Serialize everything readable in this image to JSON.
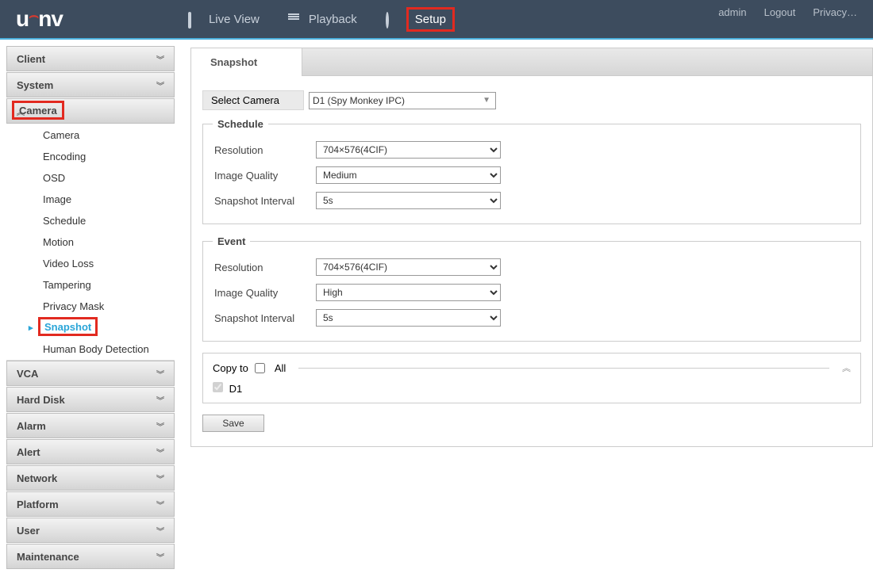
{
  "header": {
    "logo": "unv",
    "nav": {
      "live": "Live View",
      "playback": "Playback",
      "setup": "Setup"
    },
    "user": {
      "name": "admin",
      "logout": "Logout",
      "privacy": "Privacy…"
    }
  },
  "sidebar": {
    "client": "Client",
    "system": "System",
    "camera": "Camera",
    "camera_items": {
      "camera": "Camera",
      "encoding": "Encoding",
      "osd": "OSD",
      "image": "Image",
      "schedule": "Schedule",
      "motion": "Motion",
      "videoloss": "Video Loss",
      "tampering": "Tampering",
      "privacymask": "Privacy Mask",
      "snapshot": "Snapshot",
      "humanbody": "Human Body Detection"
    },
    "vca": "VCA",
    "harddisk": "Hard Disk",
    "alarm": "Alarm",
    "alert": "Alert",
    "network": "Network",
    "platform": "Platform",
    "user": "User",
    "maintenance": "Maintenance"
  },
  "tab": {
    "snapshot": "Snapshot"
  },
  "form": {
    "select_camera_label": "Select Camera",
    "select_camera_value": "D1 (Spy Monkey IPC)",
    "schedule_legend": "Schedule",
    "event_legend": "Event",
    "resolution_label": "Resolution",
    "quality_label": "Image Quality",
    "interval_label": "Snapshot Interval",
    "schedule": {
      "resolution": "704×576(4CIF)",
      "quality": "Medium",
      "interval": "5s"
    },
    "event": {
      "resolution": "704×576(4CIF)",
      "quality": "High",
      "interval": "5s"
    },
    "copy_to": "Copy to",
    "all": "All",
    "d1": "D1",
    "save": "Save"
  }
}
